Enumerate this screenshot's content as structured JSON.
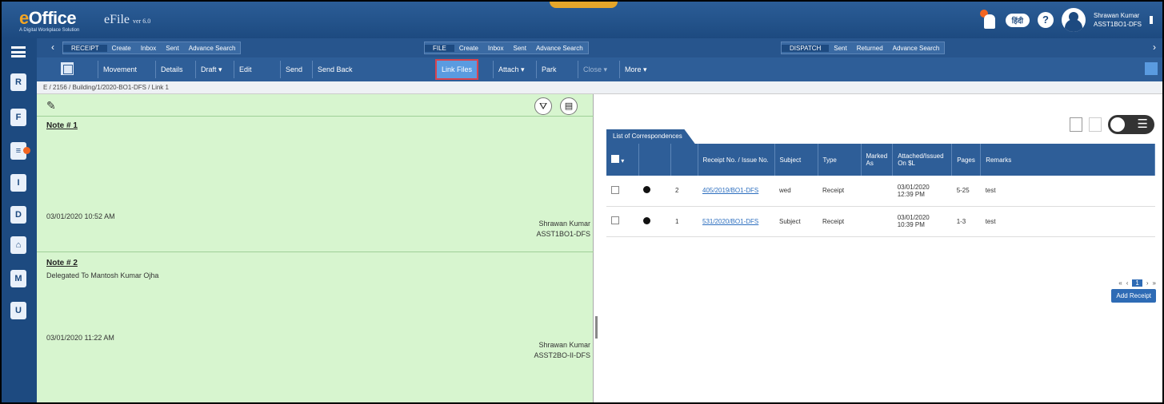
{
  "header": {
    "logo": "eOffice",
    "logo_sub": "A Digital Workplace Solution",
    "app_name": "eFile",
    "version": "ver 6.0",
    "lang_pill": "हिंदी",
    "help": "?",
    "user_name": "Shrawan Kumar",
    "user_designation": "ASST1BO1-DFS"
  },
  "nav": {
    "receipt_head": "RECEIPT",
    "receipt_items": [
      "Create",
      "Inbox",
      "Sent",
      "Advance Search"
    ],
    "file_head": "FILE",
    "file_items": [
      "Create",
      "Inbox",
      "Sent",
      "Advance Search"
    ],
    "dispatch_head": "DISPATCH",
    "dispatch_items": [
      "Sent",
      "Returned",
      "Advance Search"
    ]
  },
  "toolbar": {
    "movement": "Movement",
    "details": "Details",
    "draft": "Draft ▾",
    "edit": "Edit",
    "send": "Send",
    "send_back": "Send Back",
    "link_files": "Link Files",
    "attach": "Attach ▾",
    "park": "Park",
    "close": "Close ▾",
    "more": "More ▾"
  },
  "breadcrumb": "E / 2156 / Building/1/2020-BO1-DFS / Link 1",
  "notes": [
    {
      "title": "Note # 1",
      "body": "",
      "date": "03/01/2020 10:52 AM",
      "signer": "Shrawan Kumar",
      "designation": "ASST1BO1-DFS"
    },
    {
      "title": "Note # 2",
      "body": "Delegated To Mantosh Kumar Ojha",
      "date": "03/01/2020 11:22 AM",
      "signer": "Shrawan Kumar",
      "designation": "ASST2BO-II-DFS"
    }
  ],
  "correspondence": {
    "tab_label": "List of Correspondences",
    "columns": [
      "",
      "",
      "",
      "Receipt No. / Issue No.",
      "Subject",
      "Type",
      "Marked As",
      "Attached/Issued On $L",
      "Pages",
      "Remarks"
    ],
    "rows": [
      {
        "num": "2",
        "receipt_no": "405/2019/BO1-DFS",
        "subject": "wed",
        "type": "Receipt",
        "marked_as": "",
        "date": "03/01/2020",
        "time": "12:39 PM",
        "pages": "5-25",
        "remarks": "test"
      },
      {
        "num": "1",
        "receipt_no": "531/2020/BO1-DFS",
        "subject": "Subject",
        "type": "Receipt",
        "marked_as": "",
        "date": "03/01/2020",
        "time": "10:39 PM",
        "pages": "1-3",
        "remarks": "test"
      }
    ],
    "pager": {
      "first": "«",
      "prev": "‹",
      "current": "1",
      "next": "›",
      "last": "»"
    },
    "add_receipt": "Add Receipt"
  },
  "colors": {
    "header_blue": "#1d4a80",
    "toolbar_blue": "#2e5e98",
    "notes_green": "#d7f5cf",
    "active_outline": "#d9434e",
    "accent_orange": "#f26522"
  }
}
